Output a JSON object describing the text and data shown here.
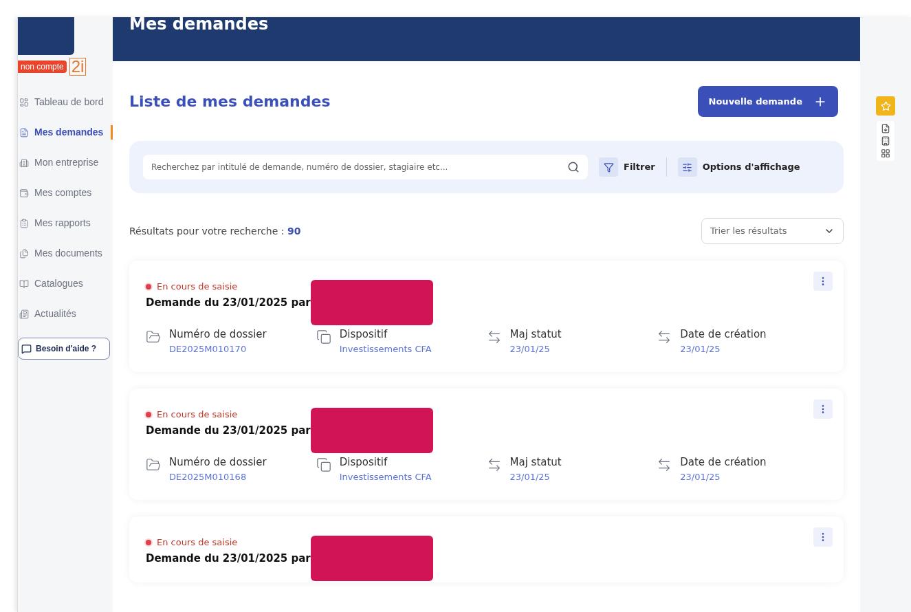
{
  "logo": {
    "badge": "non compte",
    "mark": "2i"
  },
  "sidebar": {
    "items": [
      {
        "label": "Tableau de bord",
        "selected": false
      },
      {
        "label": "Mes demandes",
        "selected": true
      },
      {
        "label": "Mon entreprise",
        "selected": false
      },
      {
        "label": "Mes comptes",
        "selected": false
      },
      {
        "label": "Mes rapports",
        "selected": false
      },
      {
        "label": "Mes documents",
        "selected": false
      },
      {
        "label": "Catalogues",
        "selected": false
      },
      {
        "label": "Actualités",
        "selected": false
      }
    ],
    "help_button": "Besoin d'aide ?"
  },
  "header": {
    "title": "Mes demandes"
  },
  "page_title": "Liste de mes demandes",
  "new_button": "Nouvelle demande",
  "search": {
    "placeholder": "Recherchez par intitulé de demande, numéro de dossier, stagiaire etc..."
  },
  "filter_button": "Filtrer",
  "display_button": "Options d'affichage",
  "results": {
    "label": "Résultats pour votre recherche : ",
    "count": "90"
  },
  "sort": {
    "placeholder": "Trier les résultats"
  },
  "cards": [
    {
      "status": "En cours de saisie",
      "title": "Demande du 23/01/2025 par",
      "redacted": true,
      "fields": [
        {
          "kind": "folder",
          "label": "Numéro de dossier",
          "value": "DE2025M010170"
        },
        {
          "kind": "scheme",
          "label": "Dispositif",
          "value": "Investissements CFA"
        },
        {
          "kind": "arrows",
          "label": "Maj statut",
          "value": "23/01/25"
        },
        {
          "kind": "arrows",
          "label": "Date de création",
          "value": "23/01/25"
        }
      ]
    },
    {
      "status": "En cours de saisie",
      "title": "Demande du 23/01/2025 par",
      "redacted": true,
      "fields": [
        {
          "kind": "folder",
          "label": "Numéro de dossier",
          "value": "DE2025M010168"
        },
        {
          "kind": "scheme",
          "label": "Dispositif",
          "value": "Investissements CFA"
        },
        {
          "kind": "arrows",
          "label": "Maj statut",
          "value": "23/01/25"
        },
        {
          "kind": "arrows",
          "label": "Date de création",
          "value": "23/01/25"
        }
      ]
    },
    {
      "status": "En cours de saisie",
      "title": "Demande du 23/01/2025 par",
      "redacted": true
    }
  ]
}
